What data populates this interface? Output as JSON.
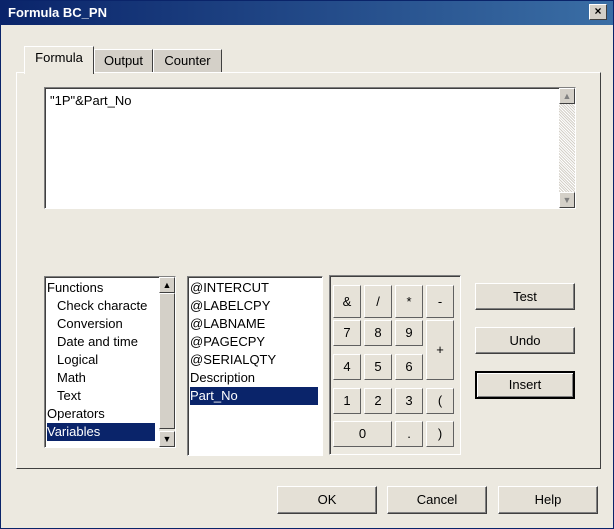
{
  "window": {
    "title": "Formula BC_PN",
    "close_label": "×"
  },
  "tabs": [
    {
      "label": "Formula",
      "active": true
    },
    {
      "label": "Output",
      "active": false
    },
    {
      "label": "Counter",
      "active": false
    }
  ],
  "formula": {
    "value": "\"1P\"&Part_No"
  },
  "categories": {
    "items": [
      {
        "label": "Functions",
        "indent": 0
      },
      {
        "label": "Check characte",
        "indent": 1
      },
      {
        "label": "Conversion",
        "indent": 1
      },
      {
        "label": "Date and time",
        "indent": 1
      },
      {
        "label": "Logical",
        "indent": 1
      },
      {
        "label": "Math",
        "indent": 1
      },
      {
        "label": "Text",
        "indent": 1
      },
      {
        "label": "Operators",
        "indent": 0
      },
      {
        "label": "Variables",
        "indent": 0,
        "selected": true
      }
    ]
  },
  "variables": {
    "items": [
      {
        "label": "@INTERCUT"
      },
      {
        "label": "@LABELCPY"
      },
      {
        "label": "@LABNAME"
      },
      {
        "label": "@PAGECPY"
      },
      {
        "label": "@SERIALQTY"
      },
      {
        "label": "Description"
      },
      {
        "label": "Part_No",
        "selected": true
      }
    ]
  },
  "keypad": {
    "amp": "&",
    "slash": "/",
    "star": "*",
    "minus": "-",
    "k7": "7",
    "k8": "8",
    "k9": "9",
    "plus": "+",
    "k4": "4",
    "k5": "5",
    "k6": "6",
    "k1": "1",
    "k2": "2",
    "k3": "3",
    "lparen": "(",
    "k0": "0",
    "dot": ".",
    "rparen": ")"
  },
  "actions": {
    "test": "Test",
    "undo": "Undo",
    "insert": "Insert"
  },
  "footer": {
    "ok": "OK",
    "cancel": "Cancel",
    "help": "Help"
  },
  "colors": {
    "title_bar": "#0a246a",
    "selection": "#0a246a",
    "dialog_bg": "#ece9e0"
  }
}
